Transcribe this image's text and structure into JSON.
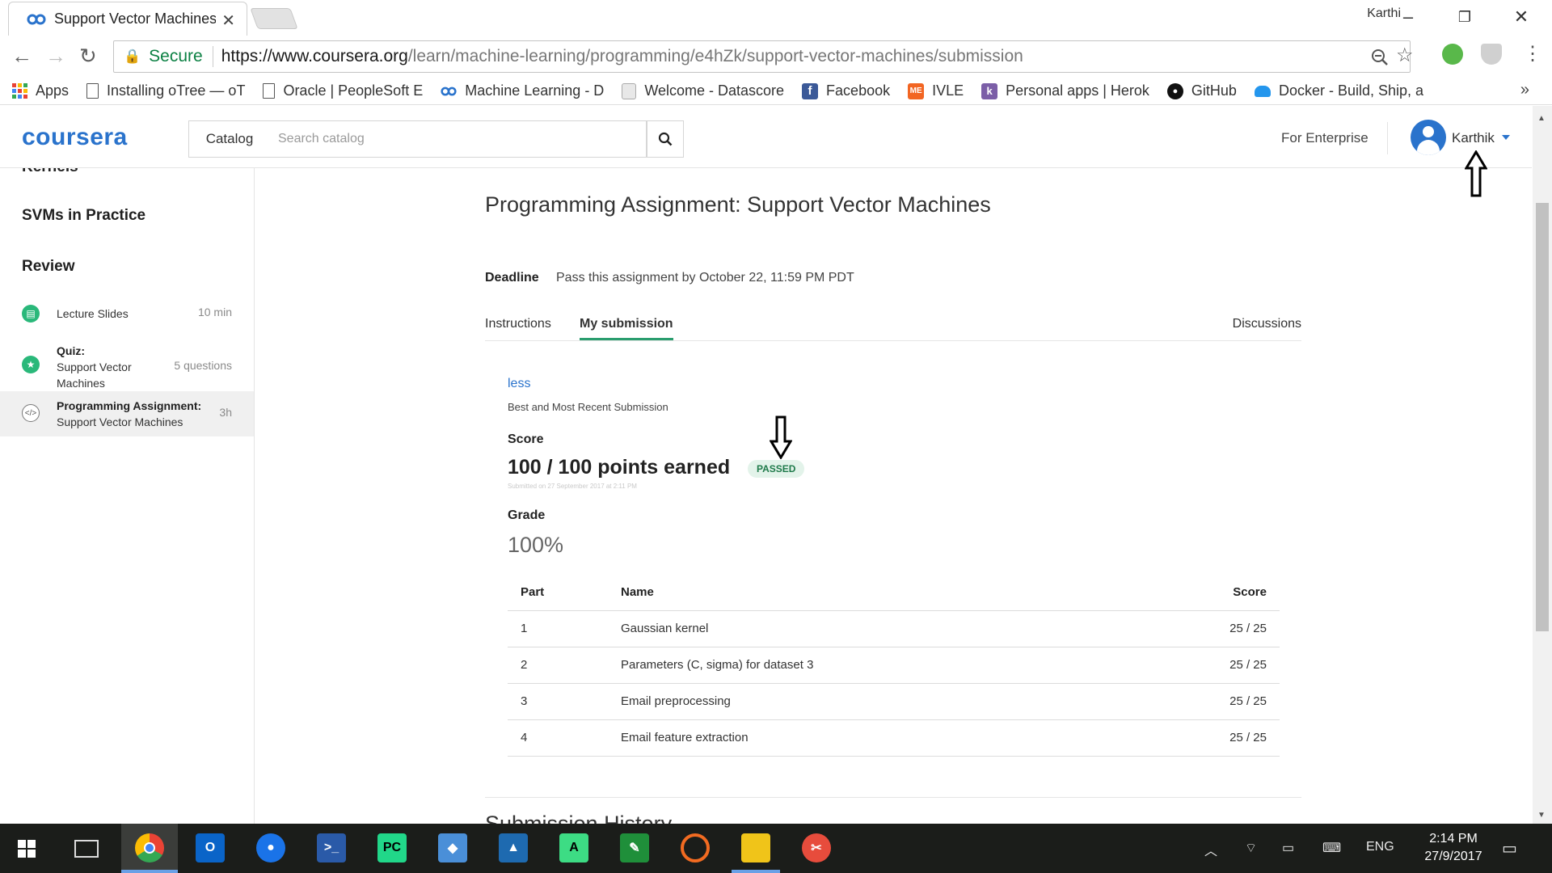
{
  "browser": {
    "tab_title": "Support Vector Machines",
    "window_user": "Karthi",
    "secure_label": "Secure",
    "url_host": "https://www.coursera.org",
    "url_path": "/learn/machine-learning/programming/e4hZk/support-vector-machines/submission"
  },
  "bookmarks": [
    {
      "label": "Apps",
      "icon": "apps-grid-icon"
    },
    {
      "label": "Installing oTree — oT",
      "icon": "page-icon"
    },
    {
      "label": "Oracle | PeopleSoft E",
      "icon": "page-icon"
    },
    {
      "label": "Machine Learning - D",
      "icon": "coursera-icon"
    },
    {
      "label": "Welcome - Datascore",
      "icon": "doc-icon"
    },
    {
      "label": "Facebook",
      "icon": "facebook-icon"
    },
    {
      "label": "IVLE",
      "icon": "ivle-icon"
    },
    {
      "label": "Personal apps | Herok",
      "icon": "heroku-icon"
    },
    {
      "label": "GitHub",
      "icon": "github-icon"
    },
    {
      "label": "Docker - Build, Ship, a",
      "icon": "docker-icon"
    }
  ],
  "header": {
    "logo": "coursera",
    "catalog_label": "Catalog",
    "search_placeholder": "Search catalog",
    "enterprise_label": "For Enterprise",
    "user_name": "Karthik"
  },
  "sidebar": {
    "cut_heading": "Kernels",
    "sections": [
      {
        "title": "SVMs in Practice"
      },
      {
        "title": "Review"
      }
    ],
    "items": [
      {
        "title": "",
        "name": "Lecture Slides",
        "meta": "10 min",
        "icon": "slides-icon"
      },
      {
        "title": "Quiz:",
        "name": "Support Vector Machines",
        "name_line1": "Support Vector",
        "name_line2": "Machines",
        "meta": "5 questions",
        "icon": "quiz-star-icon"
      },
      {
        "title": "Programming Assignment:",
        "name": "Support Vector Machines",
        "meta": "3h",
        "icon": "code-icon"
      }
    ]
  },
  "main": {
    "title": "Programming Assignment: Support Vector Machines",
    "deadline_label": "Deadline",
    "deadline_text": "Pass this assignment by October 22, 11:59 PM PDT",
    "tabs": [
      {
        "label": "Instructions"
      },
      {
        "label": "My submission"
      },
      {
        "label": "Discussions"
      }
    ],
    "less_link": "less",
    "best_recent": "Best and Most Recent Submission",
    "score_label": "Score",
    "score_value": "100 / 100 points earned",
    "passed_badge": "PASSED",
    "submitted_on": "Submitted on 27 September 2017 at 2:11 PM",
    "grade_label": "Grade",
    "grade_value": "100%",
    "table": {
      "headers": {
        "part": "Part",
        "name": "Name",
        "score": "Score"
      },
      "rows": [
        {
          "part": "1",
          "name": "Gaussian kernel",
          "score": "25 / 25"
        },
        {
          "part": "2",
          "name": "Parameters (C, sigma) for dataset 3",
          "score": "25 / 25"
        },
        {
          "part": "3",
          "name": "Email preprocessing",
          "score": "25 / 25"
        },
        {
          "part": "4",
          "name": "Email feature extraction",
          "score": "25 / 25"
        }
      ]
    },
    "history_title": "Submission History"
  },
  "taskbar": {
    "language": "ENG",
    "time": "2:14 PM",
    "date": "27/9/2017"
  }
}
